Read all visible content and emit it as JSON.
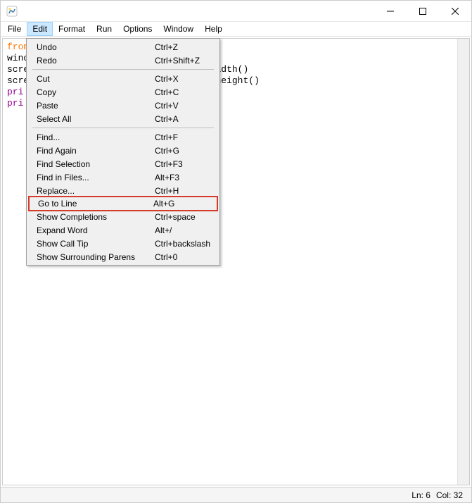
{
  "menubar": [
    "File",
    "Edit",
    "Format",
    "Run",
    "Options",
    "Window",
    "Help"
  ],
  "menubar_active_index": 1,
  "dropdown": {
    "groups": [
      [
        {
          "label": "Undo",
          "shortcut": "Ctrl+Z"
        },
        {
          "label": "Redo",
          "shortcut": "Ctrl+Shift+Z"
        }
      ],
      [
        {
          "label": "Cut",
          "shortcut": "Ctrl+X"
        },
        {
          "label": "Copy",
          "shortcut": "Ctrl+C"
        },
        {
          "label": "Paste",
          "shortcut": "Ctrl+V"
        },
        {
          "label": "Select All",
          "shortcut": "Ctrl+A"
        }
      ],
      [
        {
          "label": "Find...",
          "shortcut": "Ctrl+F"
        },
        {
          "label": "Find Again",
          "shortcut": "Ctrl+G"
        },
        {
          "label": "Find Selection",
          "shortcut": "Ctrl+F3"
        },
        {
          "label": "Find in Files...",
          "shortcut": "Alt+F3"
        },
        {
          "label": "Replace...",
          "shortcut": "Ctrl+H"
        },
        {
          "label": "Go to Line",
          "shortcut": "Alt+G",
          "highlight": true
        },
        {
          "label": "Show Completions",
          "shortcut": "Ctrl+space"
        },
        {
          "label": "Expand Word",
          "shortcut": "Alt+/"
        },
        {
          "label": "Show Call Tip",
          "shortcut": "Ctrl+backslash"
        },
        {
          "label": "Show Surrounding Parens",
          "shortcut": "Ctrl+0"
        }
      ]
    ]
  },
  "code": {
    "l1a": "from",
    "l1b": "",
    "l2": "wind",
    "l3a": "scre",
    "l3b": "nwidth()",
    "l4a": "scre",
    "l4b": "enheight()",
    "l5": "pri",
    "l6": "pri"
  },
  "status": {
    "ln": "Ln: 6",
    "col": "Col: 32"
  }
}
